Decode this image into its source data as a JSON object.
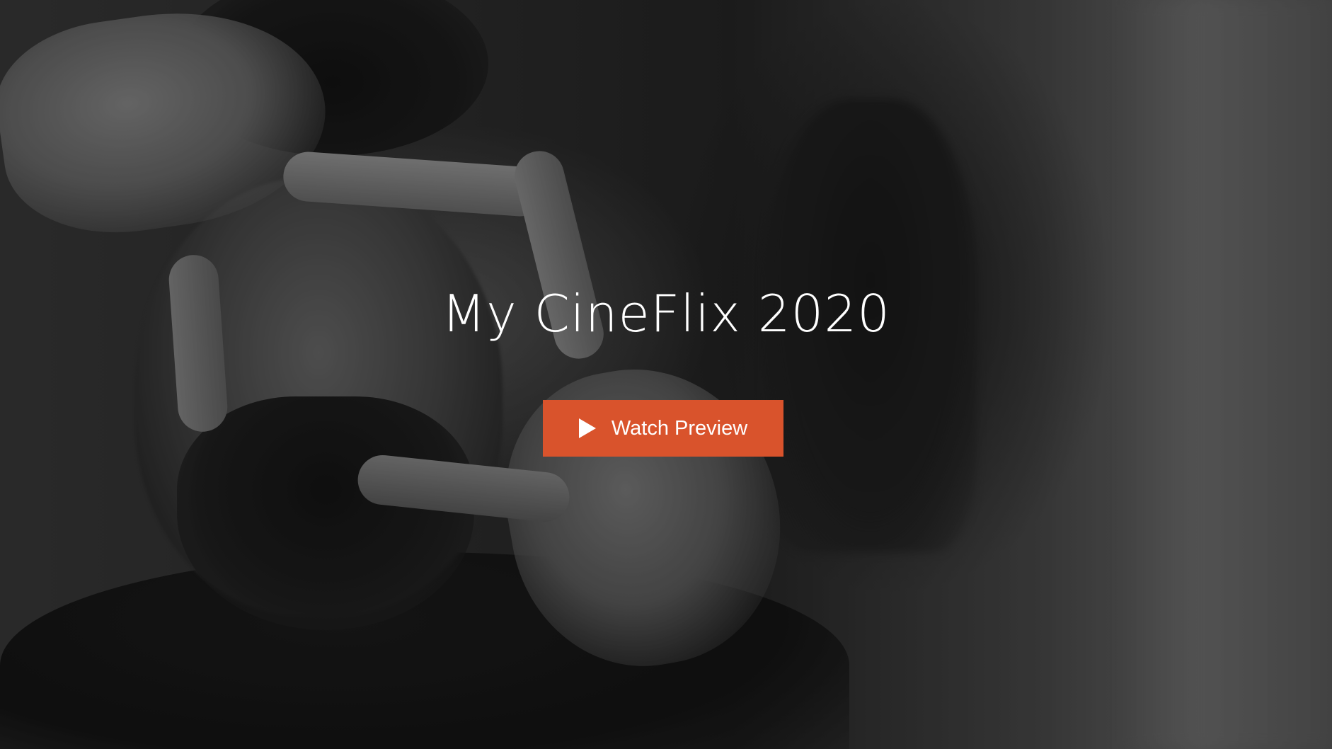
{
  "hero": {
    "title": "My CineFlix 2020",
    "cta_label": "Watch Preview",
    "cta_icon": "play-icon",
    "cta_color": "#d9532c"
  }
}
